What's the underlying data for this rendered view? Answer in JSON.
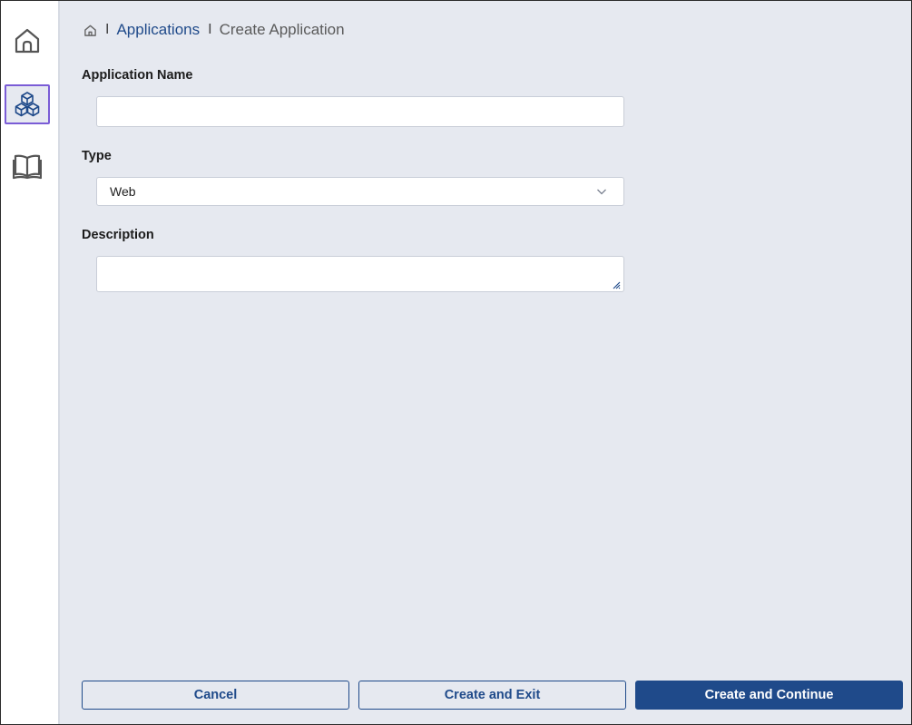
{
  "sidebar": {
    "items": [
      {
        "name": "home",
        "icon": "home-icon",
        "active": false
      },
      {
        "name": "applications",
        "icon": "cubes-icon",
        "active": true
      },
      {
        "name": "documentation",
        "icon": "book-icon",
        "active": false
      }
    ]
  },
  "breadcrumb": {
    "home_icon": "home-icon",
    "separator": "I",
    "link": "Applications",
    "current": "Create Application"
  },
  "form": {
    "name_label": "Application Name",
    "name_value": "",
    "type_label": "Type",
    "type_value": "Web",
    "description_label": "Description",
    "description_value": ""
  },
  "actions": {
    "cancel": "Cancel",
    "create_exit": "Create and Exit",
    "create_continue": "Create and Continue"
  },
  "colors": {
    "accent": "#1f4a8a",
    "active_border": "#7a5cd6",
    "background": "#e6e9f0"
  }
}
